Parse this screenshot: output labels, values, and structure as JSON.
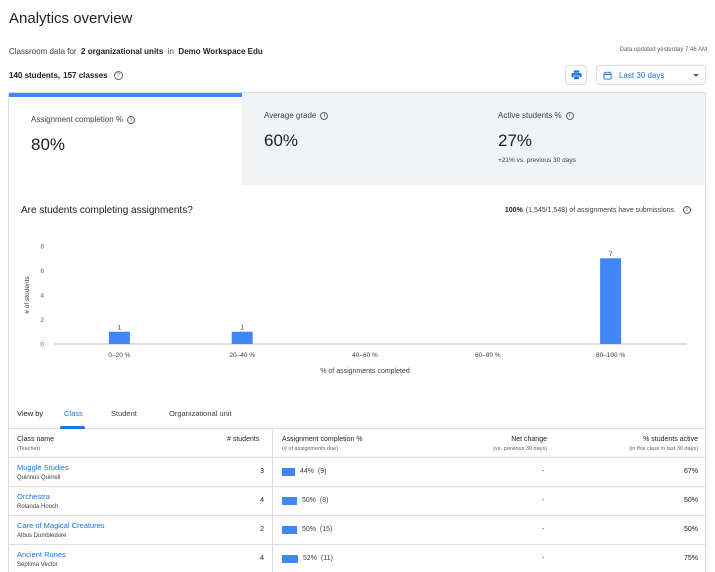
{
  "page": {
    "title": "Analytics overview",
    "scope_prefix": "Classroom data for",
    "scope_units": "2 organizational units",
    "scope_in": "in",
    "scope_domain": "Demo Workspace Edu",
    "updated": "Data updated yesterday 7:46 AM",
    "students_count": "140 students,",
    "classes_count": "157 classes"
  },
  "toolbar": {
    "print_icon": "print-icon",
    "date_range_label": "Last 30 days",
    "calendar_icon": "calendar-icon"
  },
  "metrics": [
    {
      "label": "Assignment completion %",
      "value": "80%",
      "sub": ""
    },
    {
      "label": "Average grade",
      "value": "60%",
      "sub": ""
    },
    {
      "label": "Active students %",
      "value": "27%",
      "sub": "+21% vs. previous 30 days"
    }
  ],
  "chart_section": {
    "title": "Are students completing assignments?",
    "submissions_bold": "100%",
    "submissions_rest": "(1,545/1,548) of assignments have submissions."
  },
  "chart_data": {
    "type": "bar",
    "categories": [
      "0–20 %",
      "20–40 %",
      "40–60 %",
      "60–80 %",
      "80–100 %"
    ],
    "values": [
      1,
      1,
      0,
      0,
      7
    ],
    "xlabel": "% of assignments completed",
    "ylabel": "# of students",
    "ylim": [
      0,
      8
    ],
    "yticks": [
      0,
      2,
      4,
      6,
      8
    ],
    "bar_color": "#4285f4",
    "grid": false
  },
  "view_by": {
    "label": "View by",
    "tabs": [
      "Class",
      "Student",
      "Organizational unit"
    ],
    "selected": "Class"
  },
  "table": {
    "headers": {
      "class_name": "Class name",
      "class_name_sub": "(Teacher)",
      "students": "# students",
      "completion": "Assignment completion %",
      "completion_sub": "(# of assignments due)",
      "net_change": "Net change",
      "net_change_sub": "(vs. previous 30 days)",
      "active": "% students active",
      "active_sub": "(in this class in last 30 days)"
    },
    "rows": [
      {
        "name": "Muggle Studies",
        "teacher": "Quirinus Quirrell",
        "students": "3",
        "completion_pct": 44,
        "completion_text": "44%",
        "due": "(9)",
        "net": "-",
        "active": "67%"
      },
      {
        "name": "Orchestra",
        "teacher": "Rolanda Hooch",
        "students": "4",
        "completion_pct": 50,
        "completion_text": "50%",
        "due": "(8)",
        "net": "-",
        "active": "50%"
      },
      {
        "name": "Care of Magical Creatures",
        "teacher": "Albus Dumbledore",
        "students": "2",
        "completion_pct": 50,
        "completion_text": "50%",
        "due": "(15)",
        "net": "-",
        "active": "50%"
      },
      {
        "name": "Ancient Runes",
        "teacher": "Septima Vector",
        "students": "4",
        "completion_pct": 52,
        "completion_text": "52%",
        "due": "(11)",
        "net": "-",
        "active": "75%"
      }
    ]
  }
}
